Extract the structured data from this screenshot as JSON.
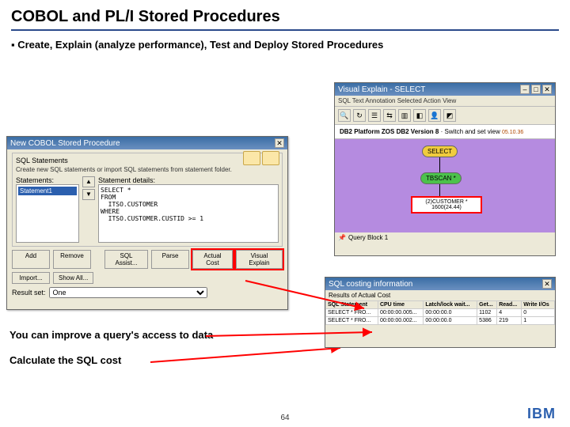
{
  "title": "COBOL and PL/I Stored Procedures",
  "bullet": "Create, Explain (analyze performance), Test and Deploy Stored Procedures",
  "dlg_left": {
    "title": "New COBOL Stored Procedure",
    "section": "SQL Statements",
    "desc": "Create new SQL statements or import SQL statements from statement folder.",
    "statements_label": "Statements:",
    "detail_label": "Statement details:",
    "stmt_selected": "Statement1",
    "sql": "SELECT *\nFROM\n  ITSO.CUSTOMER\nWHERE\n  ITSO.CUSTOMER.CUSTID >= 1",
    "buttons": {
      "add": "Add",
      "remove": "Remove",
      "sqlassist": "SQL Assist...",
      "parse": "Parse",
      "actualcost": "Actual Cost",
      "visualexplain": "Visual Explain"
    },
    "importrow": {
      "import": "Import...",
      "showall": "Show All..."
    },
    "resultset_label": "Result set:",
    "resultset_value": "One"
  },
  "dlg_ve": {
    "title": "Visual Explain - SELECT",
    "menu": "SQL Text   Annotation   Selected   Action   View",
    "info_label": "DB2 Platform ZOS  DB2 Version 8",
    "info_sub": "Switch and set view",
    "info_ver": "05.10.36",
    "node1": "SELECT",
    "node2": "TBSCAN *",
    "node3a": "(2)CUSTOMER *",
    "node3b": "1600(24.44)",
    "status": "Query Block 1"
  },
  "dlg_cost": {
    "title": "SQL costing information",
    "subtitle": "Results of Actual Cost",
    "headers": [
      "SQL Statement",
      "CPU time",
      "Latch/lock wait...",
      "Get...",
      "Read...",
      "Write I/Os"
    ],
    "rows": [
      [
        "SELECT * FRO...",
        "00:00:00.005...",
        "00:00:00.0",
        "1102",
        "4",
        "0"
      ],
      [
        "SELECT * FRO...",
        "00:00:00.002...",
        "00:00:00.0",
        "5386",
        "219",
        "1"
      ]
    ]
  },
  "callouts": {
    "c1": "You can improve a query's access to data",
    "c2": "Calculate the SQL cost"
  },
  "footer": {
    "page": "64",
    "logo": "IBM"
  }
}
